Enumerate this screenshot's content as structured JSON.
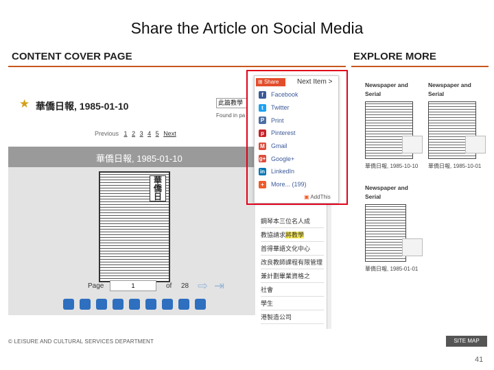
{
  "slide": {
    "title": "Share the Article on Social Media",
    "page_number": "41"
  },
  "left_panel": {
    "section_title": "CONTENT COVER PAGE",
    "article_title": "華僑日報, 1985-01-10",
    "search_tab_label": "此篇教學",
    "found_in_page_label": "Found in pa",
    "pager": {
      "previous": "Previous",
      "pages": [
        "1",
        "2",
        "3",
        "4",
        "5"
      ],
      "next": "Next"
    },
    "viewer_title": "華僑日報, 1985-01-10",
    "page_label": "Page",
    "page_value": "1",
    "of_label": "of",
    "total_pages": "28"
  },
  "share": {
    "button_label": "Share",
    "next_item_label": "Next Item >",
    "items": [
      {
        "label": "Facebook",
        "color": "#3b5998",
        "glyph": "f"
      },
      {
        "label": "Twitter",
        "color": "#1da1f2",
        "glyph": "t"
      },
      {
        "label": "Print",
        "color": "#4a6fa5",
        "glyph": "P"
      },
      {
        "label": "Pinterest",
        "color": "#cb2027",
        "glyph": "p"
      },
      {
        "label": "Gmail",
        "color": "#dd4b39",
        "glyph": "M"
      },
      {
        "label": "Google+",
        "color": "#dd4b39",
        "glyph": "g+"
      },
      {
        "label": "LinkedIn",
        "color": "#0077b5",
        "glyph": "in"
      },
      {
        "label": "More... (199)",
        "color": "#f05a28",
        "glyph": "+"
      }
    ],
    "addthis_label": "AddThis"
  },
  "text_list": {
    "items": [
      "鋼琴本三位名人成",
      "教協請求將教學",
      "首得華語文化中心",
      "改良教師課程有限管理",
      "兼計劃畢業資格之",
      "社會",
      "學生",
      "港製造公司"
    ],
    "highlight": "將教學"
  },
  "explore": {
    "section_title": "EXPLORE MORE",
    "cards": [
      {
        "heading": "Newspaper and Serial",
        "caption": "華僑日報, 1985-10-10"
      },
      {
        "heading": "Newspaper and Serial",
        "caption": "華僑日報, 1985-10-01"
      },
      {
        "heading": "Newspaper and Serial",
        "caption": "華僑日報, 1985-01-01"
      }
    ]
  },
  "footer": {
    "org_text": "© LEISURE AND CULTURAL SERVICES DEPARTMENT",
    "site_map_label": "SITE MAP"
  },
  "colors": {
    "accent": "#c8561c",
    "highlight_box": "#e0001a",
    "share_button": "#e34d2b"
  }
}
